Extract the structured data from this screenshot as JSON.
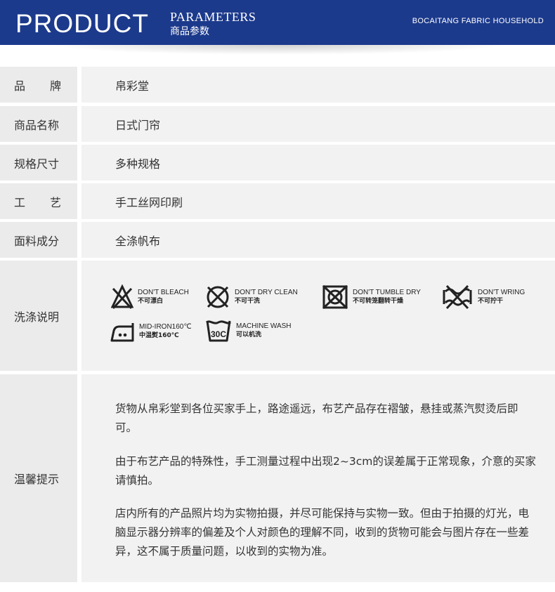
{
  "header": {
    "title_big": "PRODUCT",
    "title_small_en": "PARAMETERS",
    "title_small_cn": "商品参数",
    "brand_line": "BOCAITANG FABRIC HOUSEHOLD"
  },
  "rows": [
    {
      "label_part1": "品",
      "label_part2": "牌",
      "value": "帛彩堂"
    },
    {
      "label": "商品名称",
      "value": "日式门帘"
    },
    {
      "label": "规格尺寸",
      "value": "多种规格"
    },
    {
      "label_part1": "工",
      "label_part2": "艺",
      "value": "手工丝网印刷"
    },
    {
      "label": "面料成分",
      "value": "全涤帆布"
    }
  ],
  "care": {
    "label": "洗涤说明",
    "items": [
      {
        "icon": "no-bleach-icon",
        "en": "DON'T BLEACH",
        "cn": "不可漂白"
      },
      {
        "icon": "no-dry-clean-icon",
        "en": "DON'T DRY CLEAN",
        "cn": "不可干洗"
      },
      {
        "icon": "no-tumble-dry-icon",
        "en": "DON'T TUMBLE DRY",
        "cn": "不可转笼翻转干燥"
      },
      {
        "icon": "no-wring-icon",
        "en": "DON'T WRING",
        "cn": "不可拧干"
      },
      {
        "icon": "iron-medium-icon",
        "en": "MID-IRON160℃",
        "cn": "中温熨160℃"
      },
      {
        "icon": "machine-wash-icon",
        "en": "MACHINE WASH",
        "cn": "可以机洗",
        "temp": "30C"
      }
    ]
  },
  "tips": {
    "label": "温馨提示",
    "paragraphs": [
      "货物从帛彩堂到各位买家手上，路途遥远，布艺产品存在褶皱，悬挂或蒸汽熨烫后即可。",
      "由于布艺产品的特殊性，手工测量过程中出现2~3cm的误差属于正常现象，介意的买家请慎拍。",
      "店内所有的产品照片均为实物拍摄，并尽可能保持与实物一致。但由于拍摄的灯光，电脑显示器分辨率的偏差及个人对颜色的理解不同，收到的货物可能会与图片存在一些差异，这不属于质量问题，以收到的实物为准。"
    ]
  },
  "colors": {
    "header_bg": "#1c3a8c",
    "label_bg": "#ebebeb",
    "value_bg": "#f2f2f2"
  }
}
